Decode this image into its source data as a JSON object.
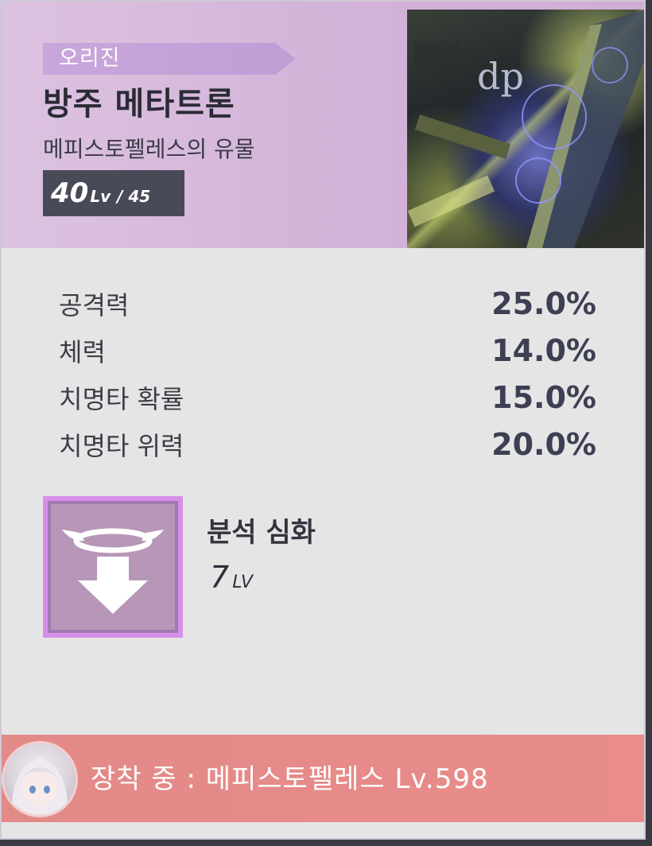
{
  "item": {
    "grade": "오리진",
    "name": "방주 메타트론",
    "set_name": "메피스토펠레스의 유물",
    "level_current": "40",
    "level_unit": "Lv",
    "level_max": "/ 45"
  },
  "stats": [
    {
      "name": "공격력",
      "value": "25.0%"
    },
    {
      "name": "체력",
      "value": "14.0%"
    },
    {
      "name": "치명타 확률",
      "value": "15.0%"
    },
    {
      "name": "치명타 위력",
      "value": "20.0%"
    }
  ],
  "skill": {
    "name": "분석 심화",
    "level_number": "7",
    "level_unit": "LV",
    "icon": "down-arrow-halo-icon"
  },
  "equipped": {
    "text": "장착 중 : 메피스토펠레스 Lv.598"
  },
  "colors": {
    "header_bg": "#d2b2d8",
    "grade_tag": "#c9a6db",
    "level_box": "#494a58",
    "skill_icon_bg": "#b796b7",
    "equip_bar": "#e98c8a"
  }
}
